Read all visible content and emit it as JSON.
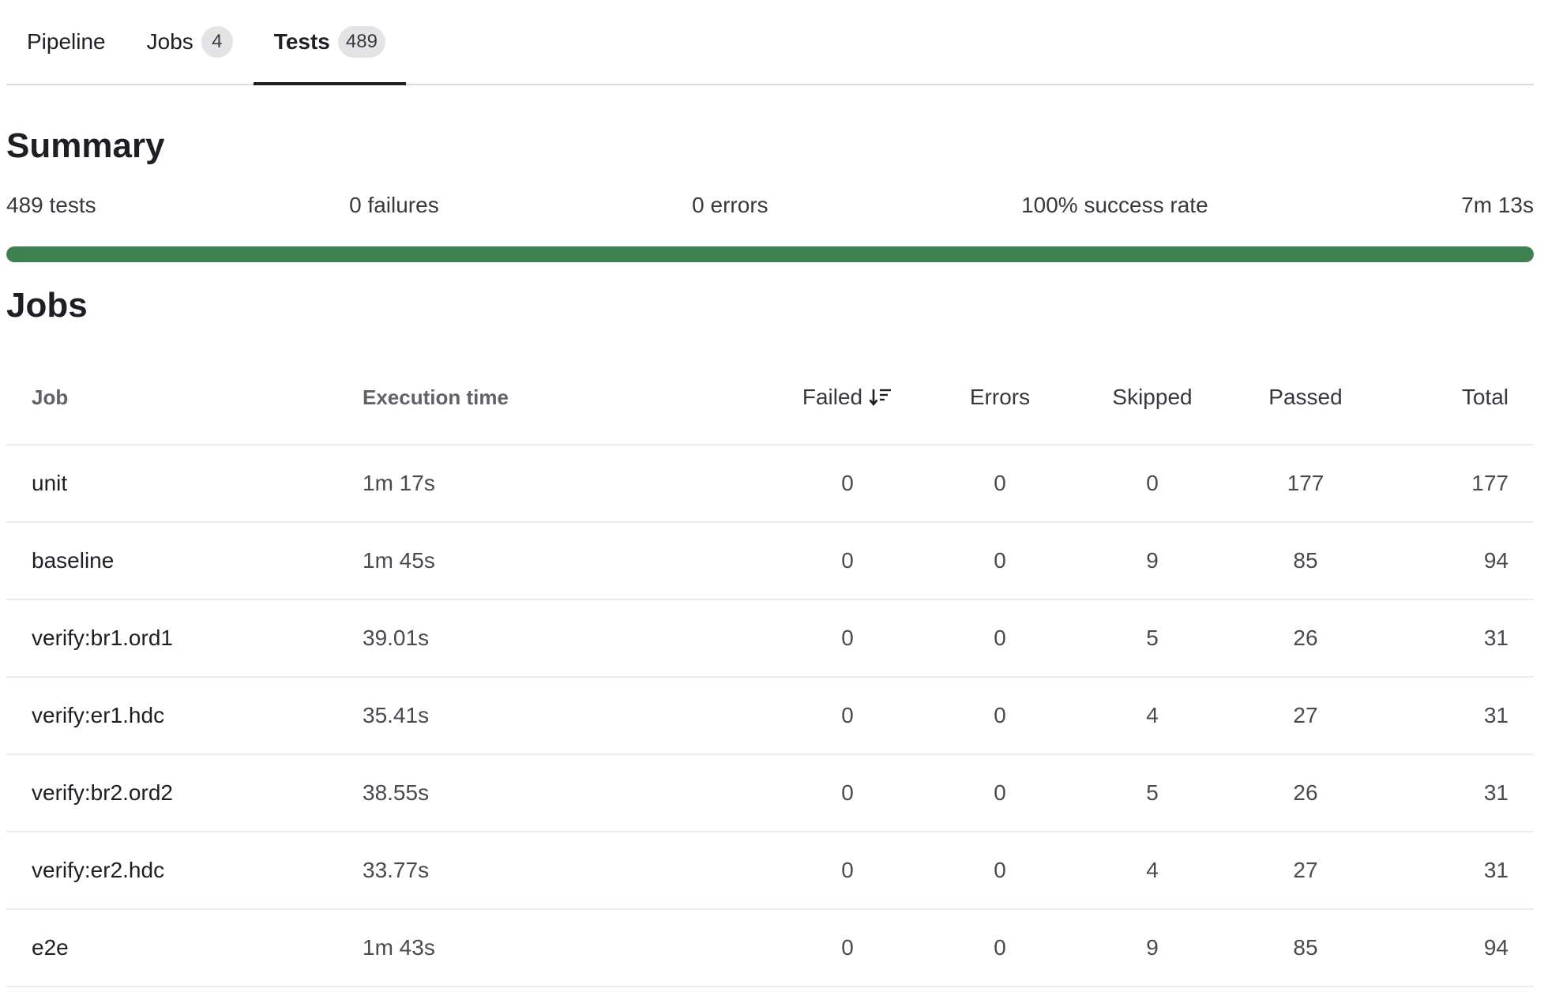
{
  "tabs": [
    {
      "label": "Pipeline",
      "badge": null,
      "active": false
    },
    {
      "label": "Jobs",
      "badge": "4",
      "active": false
    },
    {
      "label": "Tests",
      "badge": "489",
      "active": true
    }
  ],
  "summary": {
    "title": "Summary",
    "tests": "489 tests",
    "failures": "0 failures",
    "errors": "0 errors",
    "success_rate": "100% success rate",
    "duration": "7m 13s",
    "progress_fraction": 1.0,
    "progress_color": "#3e8150"
  },
  "jobs": {
    "title": "Jobs",
    "columns": {
      "job": "Job",
      "execution_time": "Execution time",
      "failed": "Failed",
      "errors": "Errors",
      "skipped": "Skipped",
      "passed": "Passed",
      "total": "Total"
    },
    "sort_icon": "sort-descending-icon",
    "rows": [
      {
        "job": "unit",
        "time": "1m 17s",
        "failed": "0",
        "errors": "0",
        "skipped": "0",
        "passed": "177",
        "total": "177"
      },
      {
        "job": "baseline",
        "time": "1m 45s",
        "failed": "0",
        "errors": "0",
        "skipped": "9",
        "passed": "85",
        "total": "94"
      },
      {
        "job": "verify:br1.ord1",
        "time": "39.01s",
        "failed": "0",
        "errors": "0",
        "skipped": "5",
        "passed": "26",
        "total": "31"
      },
      {
        "job": "verify:er1.hdc",
        "time": "35.41s",
        "failed": "0",
        "errors": "0",
        "skipped": "4",
        "passed": "27",
        "total": "31"
      },
      {
        "job": "verify:br2.ord2",
        "time": "38.55s",
        "failed": "0",
        "errors": "0",
        "skipped": "5",
        "passed": "26",
        "total": "31"
      },
      {
        "job": "verify:er2.hdc",
        "time": "33.77s",
        "failed": "0",
        "errors": "0",
        "skipped": "4",
        "passed": "27",
        "total": "31"
      },
      {
        "job": "e2e",
        "time": "1m 43s",
        "failed": "0",
        "errors": "0",
        "skipped": "9",
        "passed": "85",
        "total": "94"
      }
    ]
  }
}
